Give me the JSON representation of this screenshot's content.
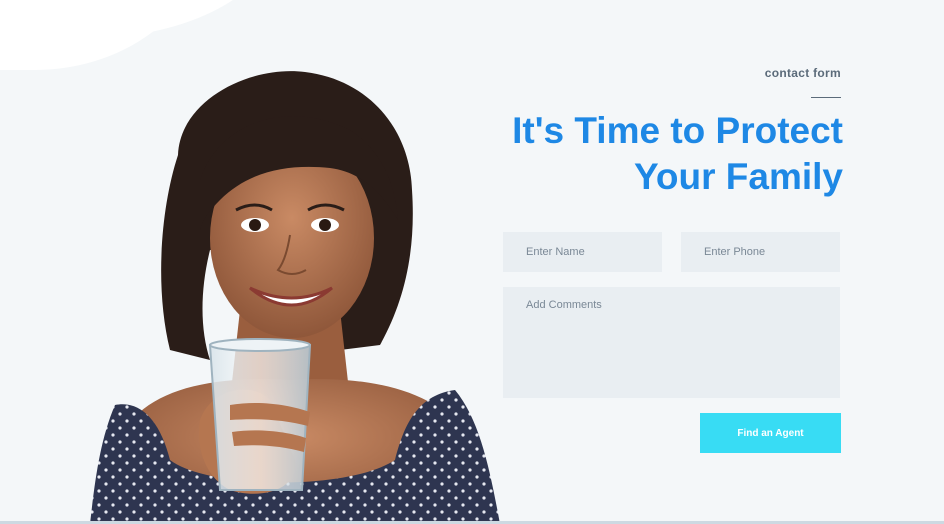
{
  "section": {
    "eyebrow": "contact form",
    "headline_line1": "It's Time to Protect",
    "headline_line2": "Your Family"
  },
  "form": {
    "name_placeholder": "Enter Name",
    "phone_placeholder": "Enter Phone",
    "comments_placeholder": "Add Comments",
    "submit_label": "Find an Agent"
  },
  "colors": {
    "headline": "#1e88e5",
    "button": "#38dcf4",
    "field_bg": "#e9eef2",
    "page_bg": "#f4f7f9"
  },
  "hero": {
    "image": "smiling-woman-holding-glass-of-water"
  }
}
